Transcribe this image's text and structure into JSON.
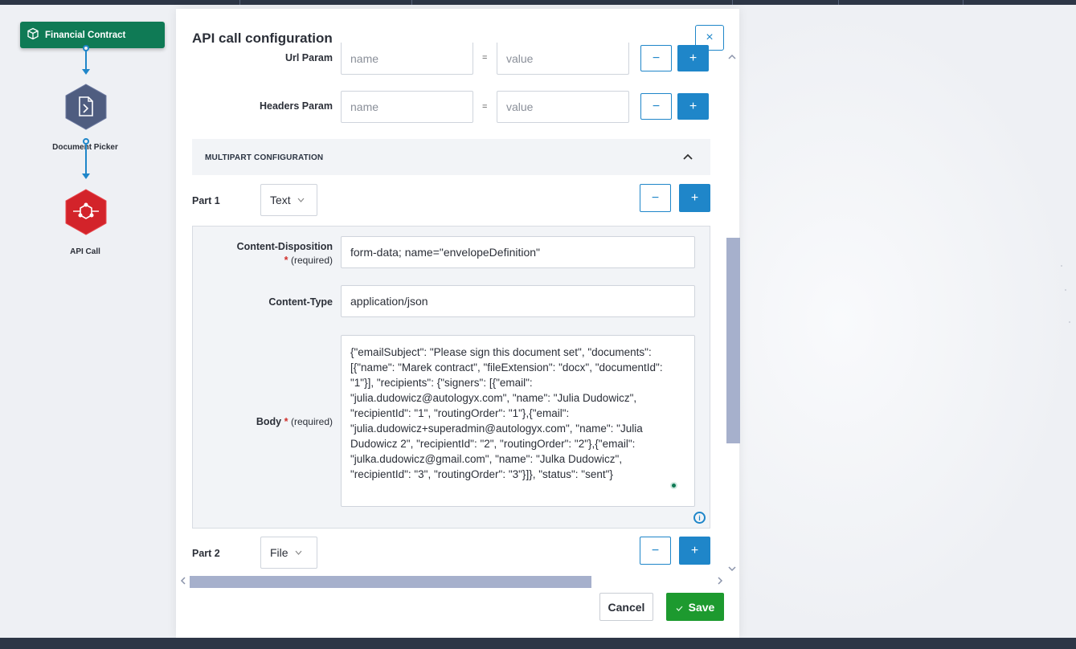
{
  "workflow": {
    "nodes": [
      {
        "label": "Financial Contract",
        "icon": "cube-icon"
      },
      {
        "label": "Document Picker",
        "icon": "document-picker-icon"
      },
      {
        "label": "API Call",
        "icon": "api-network-icon"
      }
    ]
  },
  "modal": {
    "title": "API call configuration",
    "close_label": "×",
    "url_param": {
      "label": "Url Param",
      "name_placeholder": "name",
      "value_placeholder": "value",
      "separator": "="
    },
    "headers_param": {
      "label": "Headers Param",
      "name_placeholder": "name",
      "value_placeholder": "value",
      "separator": "="
    },
    "minus_label": "−",
    "plus_label": "+",
    "multipart": {
      "title": "MULTIPART CONFIGURATION",
      "parts": [
        {
          "label": "Part 1",
          "type": "Text",
          "content_disposition_label": "Content-Disposition",
          "content_disposition_required": "(required)",
          "content_disposition_value": "form-data; name=\"envelopeDefinition\"",
          "content_type_label": "Content-Type",
          "content_type_value": "application/json",
          "body_label": "Body",
          "body_required": "(required)",
          "body_value": "{\"emailSubject\": \"Please sign this document set\", \"documents\": [{\"name\": \"Marek contract\", \"fileExtension\": \"docx\", \"documentId\": \"1\"}], \"recipients\": {\"signers\": [{\"email\": \"julia.dudowicz@autologyx.com\", \"name\": \"Julia Dudowicz\", \"recipientId\": \"1\", \"routingOrder\": \"1\"},{\"email\": \"julia.dudowicz+superadmin@autologyx.com\", \"name\": \"Julia Dudowicz 2\", \"recipientId\": \"2\", \"routingOrder\": \"2\"},{\"email\": \"julka.dudowicz@gmail.com\", \"name\": \"Julka Dudowicz\", \"recipientId\": \"3\", \"routingOrder\": \"3\"}]}, \"status\": \"sent\"}"
        },
        {
          "label": "Part 2",
          "type": "File"
        }
      ]
    },
    "required_star": "*",
    "footer": {
      "cancel_label": "Cancel",
      "save_label": "Save"
    }
  },
  "colors": {
    "primary": "#1f86c9",
    "save_green": "#1d9a2f",
    "node_green": "#0f7a55",
    "api_red": "#d3232a",
    "picker_slate": "#4f5d80"
  }
}
